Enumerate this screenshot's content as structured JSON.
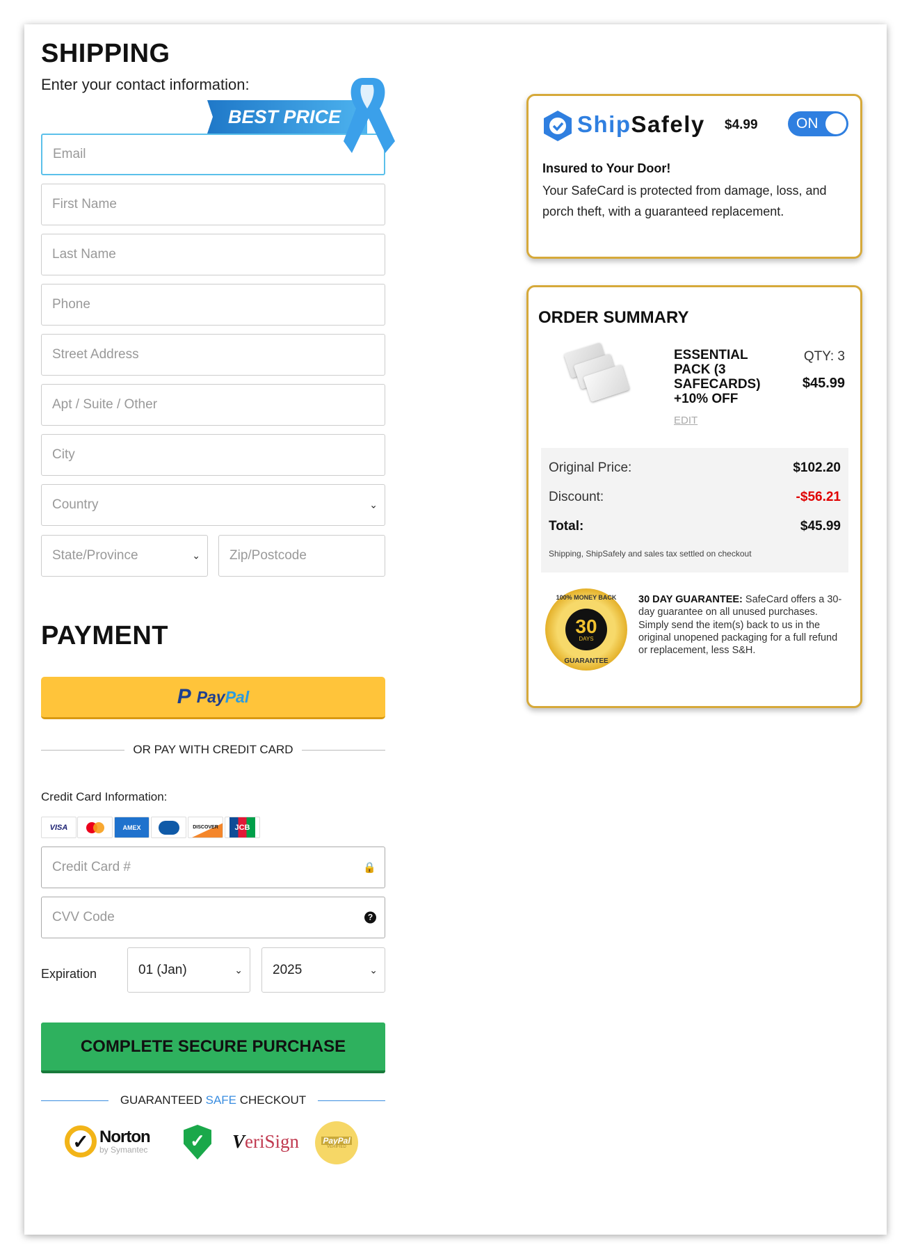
{
  "shipping": {
    "title": "SHIPPING",
    "subtitle": "Enter your contact information:",
    "ribbon": "BEST PRICE",
    "fields": {
      "email": "Email",
      "first_name": "First Name",
      "last_name": "Last Name",
      "phone": "Phone",
      "street": "Street Address",
      "apt": "Apt / Suite / Other",
      "city": "City",
      "country": "Country",
      "state": "State/Province",
      "zip": "Zip/Postcode"
    }
  },
  "payment": {
    "title": "PAYMENT",
    "paypal_pay": "Pay",
    "paypal_pal": "Pal",
    "or_pay": "OR PAY WITH CREDIT CARD",
    "cc_info": "Credit Card Information:",
    "card_brands": [
      "VISA",
      "mastercard",
      "AMEX",
      "diners",
      "DISCOVER",
      "JCB"
    ],
    "cc_placeholder": "Credit Card #",
    "cvv_placeholder": "CVV Code",
    "expiration_label": "Expiration",
    "exp_month": "01 (Jan)",
    "exp_year": "2025",
    "submit": "COMPLETE SECURE PURCHASE",
    "guaranteed_a": "GUARANTEED ",
    "guaranteed_b": "SAFE",
    "guaranteed_c": " CHECKOUT",
    "badges": {
      "norton": "Norton",
      "norton_sub": "by Symantec",
      "verisign": "VeriSign",
      "paypal_verified": "PayPal",
      "paypal_verified_sub": "VERIFIED"
    }
  },
  "shipsafely": {
    "brand_a": "Ship",
    "brand_b": "Safely",
    "price": "$4.99",
    "toggle": "ON",
    "toggle_on": true,
    "heading": "Insured to Your Door!",
    "body": "Your SafeCard is protected from damage, loss, and porch theft, with a guaranteed replacement."
  },
  "order": {
    "title": "ORDER SUMMARY",
    "item_name": "ESSENTIAL PACK (3 SAFECARDS) +10% OFF",
    "qty": "QTY: 3",
    "item_price": "$45.99",
    "edit": "EDIT",
    "original_label": "Original Price:",
    "original": "$102.20",
    "discount_label": "Discount:",
    "discount": "-$56.21",
    "total_label": "Total:",
    "total": "$45.99",
    "note": "Shipping, ShipSafely and sales tax settled on checkout",
    "guarantee_bold": "30 DAY GUARANTEE:",
    "guarantee_text": " SafeCard offers a 30-day guarantee on all unused purchases. Simply send the item(s) back to us in the original unopened packaging for a full refund or replacement, less S&H.",
    "seal_top": "100% MONEY BACK",
    "seal_num": "30",
    "seal_days": "DAYS",
    "seal_bottom": "GUARANTEE"
  },
  "colors": {
    "accent": "#2f7fe0",
    "gold": "#d6a93a",
    "green": "#2eb15e",
    "paypal": "#ffc43a",
    "discount": "#e00000"
  }
}
